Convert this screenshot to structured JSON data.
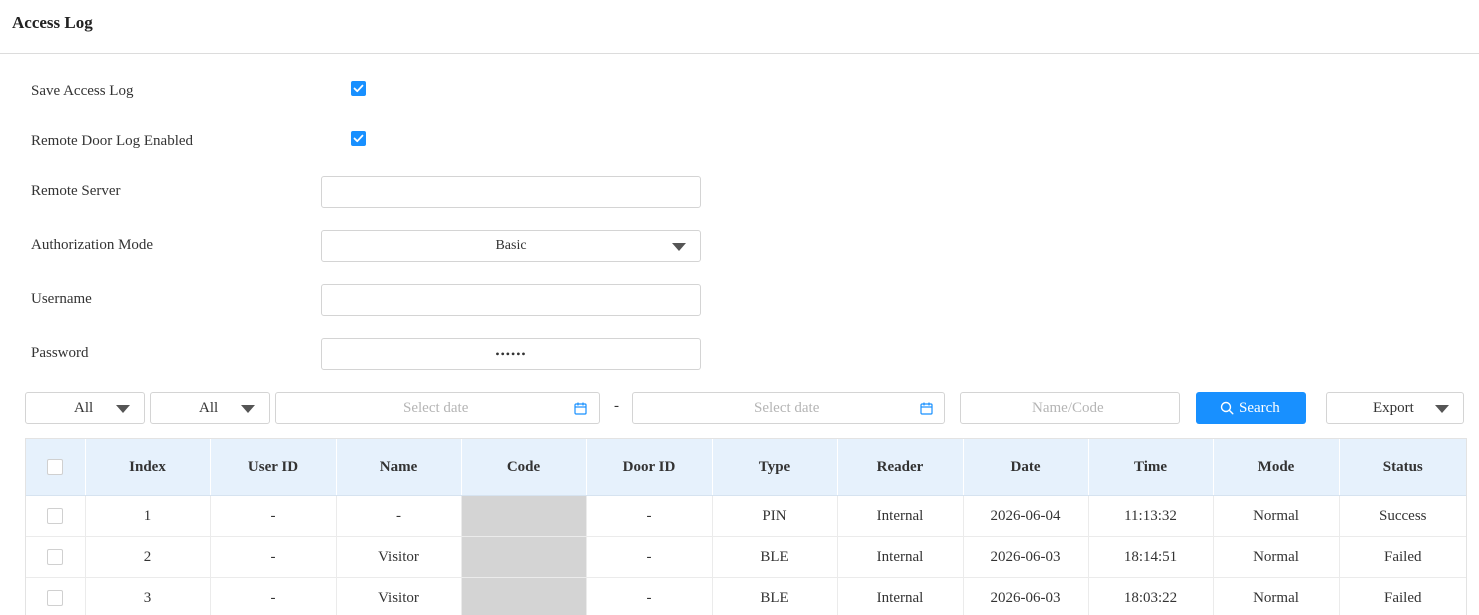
{
  "header": {
    "title": "Access Log"
  },
  "form": {
    "save_access_log": {
      "label": "Save Access Log",
      "checked": true
    },
    "remote_door_log": {
      "label": "Remote Door Log Enabled",
      "checked": true
    },
    "remote_server": {
      "label": "Remote Server",
      "value": ""
    },
    "authorization_mode": {
      "label": "Authorization Mode",
      "value": "Basic"
    },
    "username": {
      "label": "Username",
      "value": ""
    },
    "password": {
      "label": "Password",
      "value": "••••••"
    }
  },
  "filters": {
    "type_filter": "All",
    "status_filter": "All",
    "start_date_placeholder": "Select date",
    "date_separator": "-",
    "end_date_placeholder": "Select date",
    "name_code_placeholder": "Name/Code",
    "search_label": "Search",
    "export_label": "Export"
  },
  "table": {
    "columns": [
      "Index",
      "User ID",
      "Name",
      "Code",
      "Door ID",
      "Type",
      "Reader",
      "Date",
      "Time",
      "Mode",
      "Status"
    ],
    "rows": [
      {
        "index": "1",
        "user_id": "-",
        "name": "-",
        "door_id": "-",
        "type": "PIN",
        "reader": "Internal",
        "date": "2026-06-04",
        "time": "11:13:32",
        "mode": "Normal",
        "status": "Success"
      },
      {
        "index": "2",
        "user_id": "-",
        "name": "Visitor",
        "door_id": "-",
        "type": "BLE",
        "reader": "Internal",
        "date": "2026-06-03",
        "time": "18:14:51",
        "mode": "Normal",
        "status": "Failed"
      },
      {
        "index": "3",
        "user_id": "-",
        "name": "Visitor",
        "door_id": "-",
        "type": "BLE",
        "reader": "Internal",
        "date": "2026-06-03",
        "time": "18:03:22",
        "mode": "Normal",
        "status": "Failed"
      }
    ]
  },
  "colors": {
    "accent": "#1890ff",
    "header_bg": "#e6f1fc",
    "redacted": "#d4d4d4"
  }
}
